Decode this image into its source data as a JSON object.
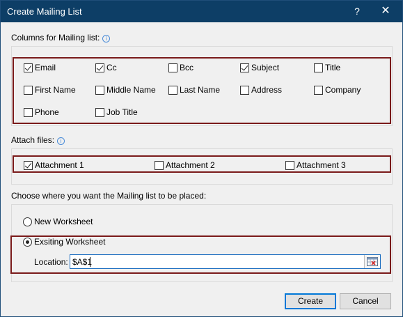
{
  "window": {
    "title": "Create Mailing List",
    "help": "?",
    "close": "✕"
  },
  "columns": {
    "label": "Columns for Mailing list:",
    "items": [
      {
        "label": "Email",
        "checked": true
      },
      {
        "label": "Cc",
        "checked": true
      },
      {
        "label": "Bcc",
        "checked": false
      },
      {
        "label": "Subject",
        "checked": true
      },
      {
        "label": "Title",
        "checked": false
      },
      {
        "label": "First Name",
        "checked": false
      },
      {
        "label": "Middle Name",
        "checked": false
      },
      {
        "label": "Last Name",
        "checked": false
      },
      {
        "label": "Address",
        "checked": false
      },
      {
        "label": "Company",
        "checked": false
      },
      {
        "label": "Phone",
        "checked": false
      },
      {
        "label": "Job Title",
        "checked": false
      }
    ]
  },
  "attach": {
    "label": "Attach files:",
    "items": [
      {
        "label": "Attachment 1",
        "checked": true
      },
      {
        "label": "Attachment 2",
        "checked": false
      },
      {
        "label": "Attachment 3",
        "checked": false
      }
    ]
  },
  "placement": {
    "label": "Choose where you want the Mailing list to be placed:",
    "options": [
      {
        "label": "New Worksheet",
        "selected": false
      },
      {
        "label": "Exsiting Worksheet",
        "selected": true
      }
    ],
    "location_label": "Location:",
    "location_value": "$A$1"
  },
  "buttons": {
    "create": "Create",
    "cancel": "Cancel"
  },
  "colors": {
    "titlebar": "#0d3e66",
    "highlight": "#7a1a1a",
    "accent": "#0078d7"
  }
}
